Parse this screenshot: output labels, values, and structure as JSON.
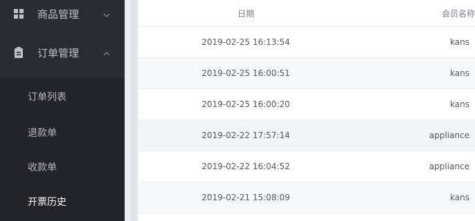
{
  "sidebar": {
    "groups": [
      {
        "label": "商品管理",
        "expanded": false,
        "icon": "grid-icon"
      },
      {
        "label": "订单管理",
        "expanded": true,
        "icon": "clipboard-icon"
      }
    ],
    "order_items": [
      {
        "label": "订单列表"
      },
      {
        "label": "退款单"
      },
      {
        "label": "收款单"
      },
      {
        "label": "开票历史"
      }
    ]
  },
  "table": {
    "headers": {
      "date": "日期",
      "member": "会员名称"
    },
    "rows": [
      {
        "date": "2019-02-25 16:13:54",
        "member": "kans"
      },
      {
        "date": "2019-02-25 16:00:51",
        "member": "kans"
      },
      {
        "date": "2019-02-25 16:00:20",
        "member": "kans"
      },
      {
        "date": "2019-02-22 17:57:14",
        "member": "appliance"
      },
      {
        "date": "2019-02-22 16:04:52",
        "member": "appliance"
      },
      {
        "date": "2019-02-21 15:08:09",
        "member": "kans"
      }
    ]
  },
  "colors": {
    "sidebar_bg": "#2b2b33",
    "submenu_bg": "#23232a",
    "active_text": "#ffffff"
  }
}
